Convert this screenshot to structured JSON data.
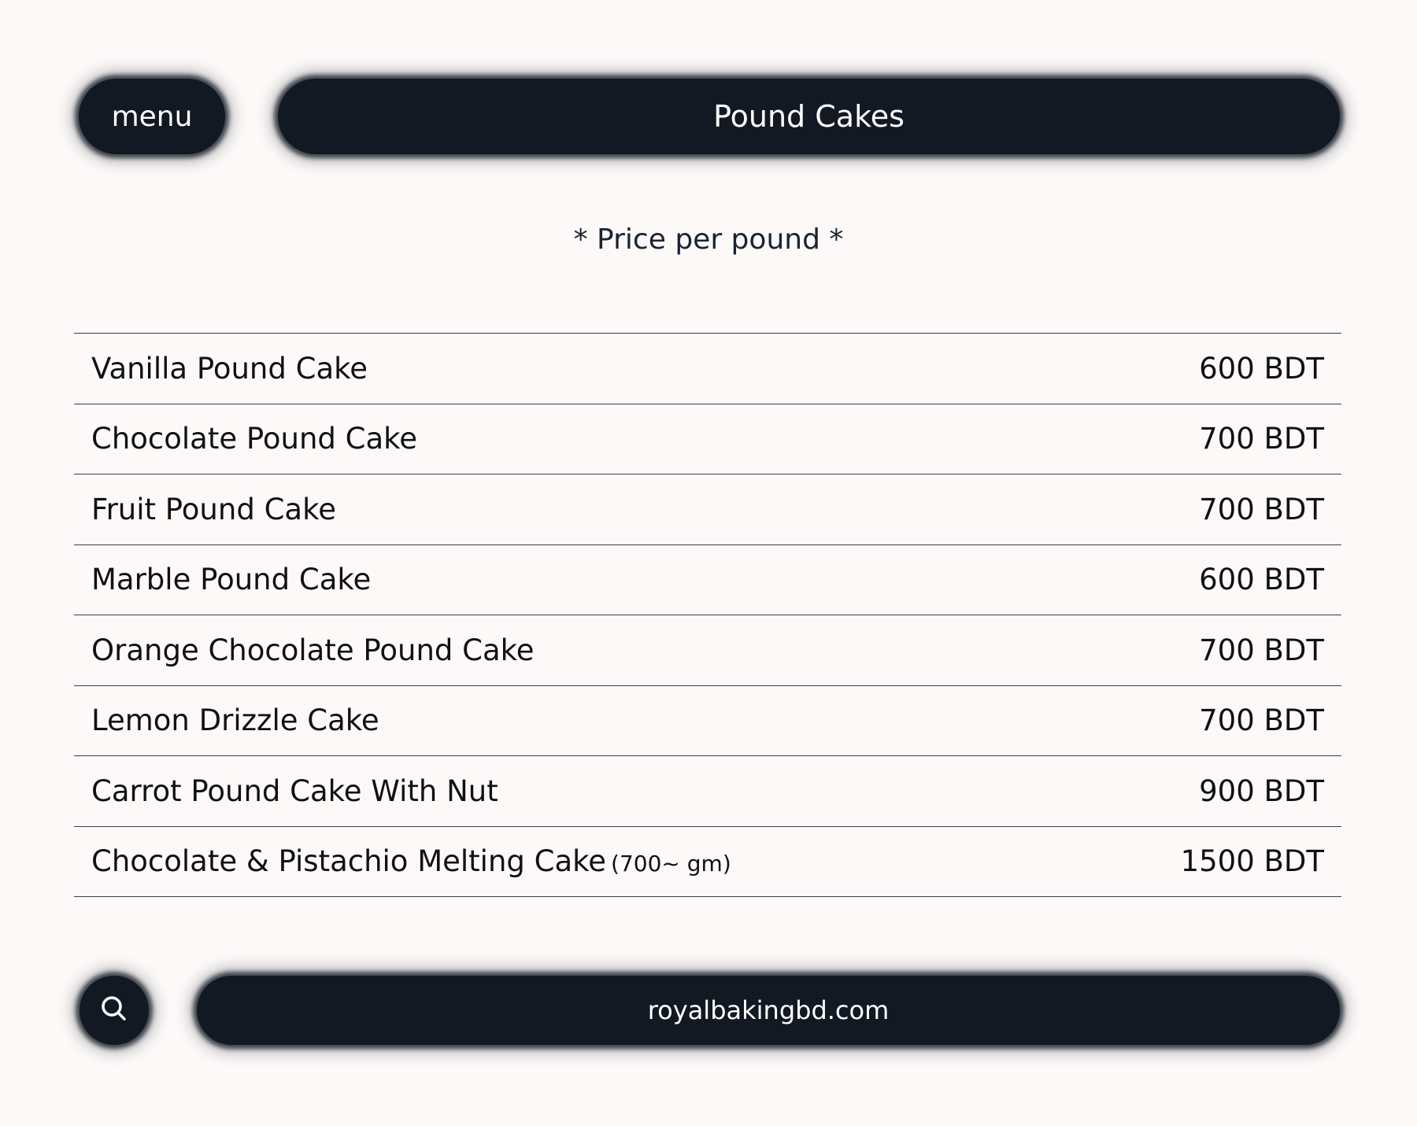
{
  "header": {
    "menu_label": "menu",
    "title": "Pound Cakes"
  },
  "subtitle": "* Price per pound *",
  "items": [
    {
      "name": "Vanilla Pound Cake",
      "note": "",
      "price": "600 BDT"
    },
    {
      "name": "Chocolate Pound Cake",
      "note": "",
      "price": "700 BDT"
    },
    {
      "name": "Fruit Pound Cake",
      "note": "",
      "price": "700 BDT"
    },
    {
      "name": "Marble Pound Cake",
      "note": "",
      "price": "600 BDT"
    },
    {
      "name": "Orange Chocolate Pound Cake",
      "note": "",
      "price": "700 BDT"
    },
    {
      "name": "Lemon Drizzle Cake",
      "note": "",
      "price": "700 BDT"
    },
    {
      "name": "Carrot Pound Cake With Nut",
      "note": "",
      "price": "900 BDT"
    },
    {
      "name": "Chocolate & Pistachio Melting Cake",
      "note": "(700~ gm)",
      "price": "1500 BDT"
    }
  ],
  "footer": {
    "search_icon": "search-icon",
    "website": "royalbakingbd.com"
  },
  "colors": {
    "background": "#fcf9f8",
    "pill": "#131923",
    "text": "#111111"
  }
}
